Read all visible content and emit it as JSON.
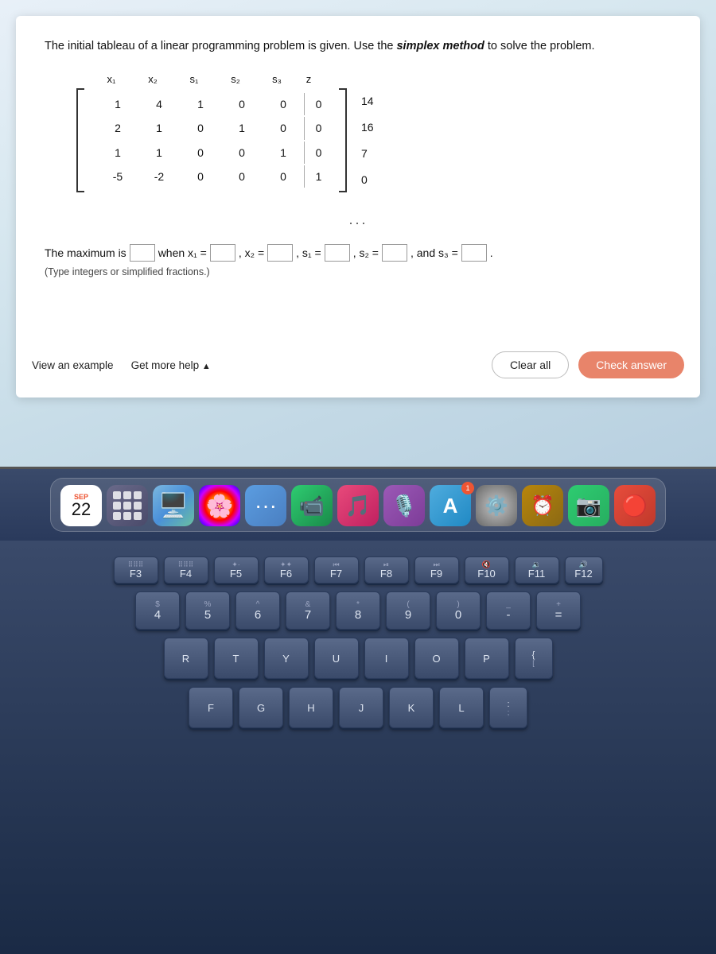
{
  "problem": {
    "statement": "The initial tableau of a linear programming problem is given. Use the simplex method to solve the problem.",
    "matrix": {
      "headers": [
        "x₁",
        "x₂",
        "s₁",
        "s₂",
        "s₃",
        "z"
      ],
      "rows": [
        [
          "1",
          "4",
          "1",
          "0",
          "0",
          "0"
        ],
        [
          "2",
          "1",
          "0",
          "1",
          "0",
          "0"
        ],
        [
          "1",
          "1",
          "0",
          "0",
          "1",
          "0"
        ],
        [
          "-5",
          "-2",
          "0",
          "0",
          "0",
          "1"
        ]
      ],
      "rhs": [
        "14",
        "16",
        "7",
        "0"
      ]
    },
    "answer_label": "The maximum is",
    "when_label": "when x₁ =",
    "x2_label": ", x₂ =",
    "s1_label": ", s₁ =",
    "s2_label": ", s₂ =",
    "s3_label": ", and s₃ =",
    "note": "(Type integers or simplified fractions.)"
  },
  "buttons": {
    "view_example": "View an example",
    "get_more_help": "Get more help",
    "get_more_help_arrow": "▲",
    "clear_all": "Clear all",
    "check_answer": "Check answer"
  },
  "dock": {
    "calendar_month": "SEP",
    "calendar_day": "22"
  },
  "keyboard": {
    "fn_row": [
      "F3",
      "F4",
      "F5",
      "F6",
      "F7",
      "F8",
      "F9",
      "F10",
      "F11"
    ],
    "num_row": [
      {
        "top": "$",
        "bot": "4"
      },
      {
        "top": "%",
        "bot": "5"
      },
      {
        "top": "^",
        "bot": "6"
      },
      {
        "top": "&",
        "bot": "7"
      },
      {
        "top": "*",
        "bot": "8"
      },
      {
        "top": "(",
        "bot": "9"
      },
      {
        "top": ")",
        "bot": "0"
      },
      {
        "top": "_",
        "bot": "-"
      },
      {
        "top": "+",
        "bot": "="
      }
    ],
    "let_row1": [
      "R",
      "T",
      "Y",
      "U",
      "I",
      "O",
      "P"
    ],
    "let_row2": [
      "F",
      "G",
      "H",
      "J",
      "K",
      "L"
    ]
  }
}
